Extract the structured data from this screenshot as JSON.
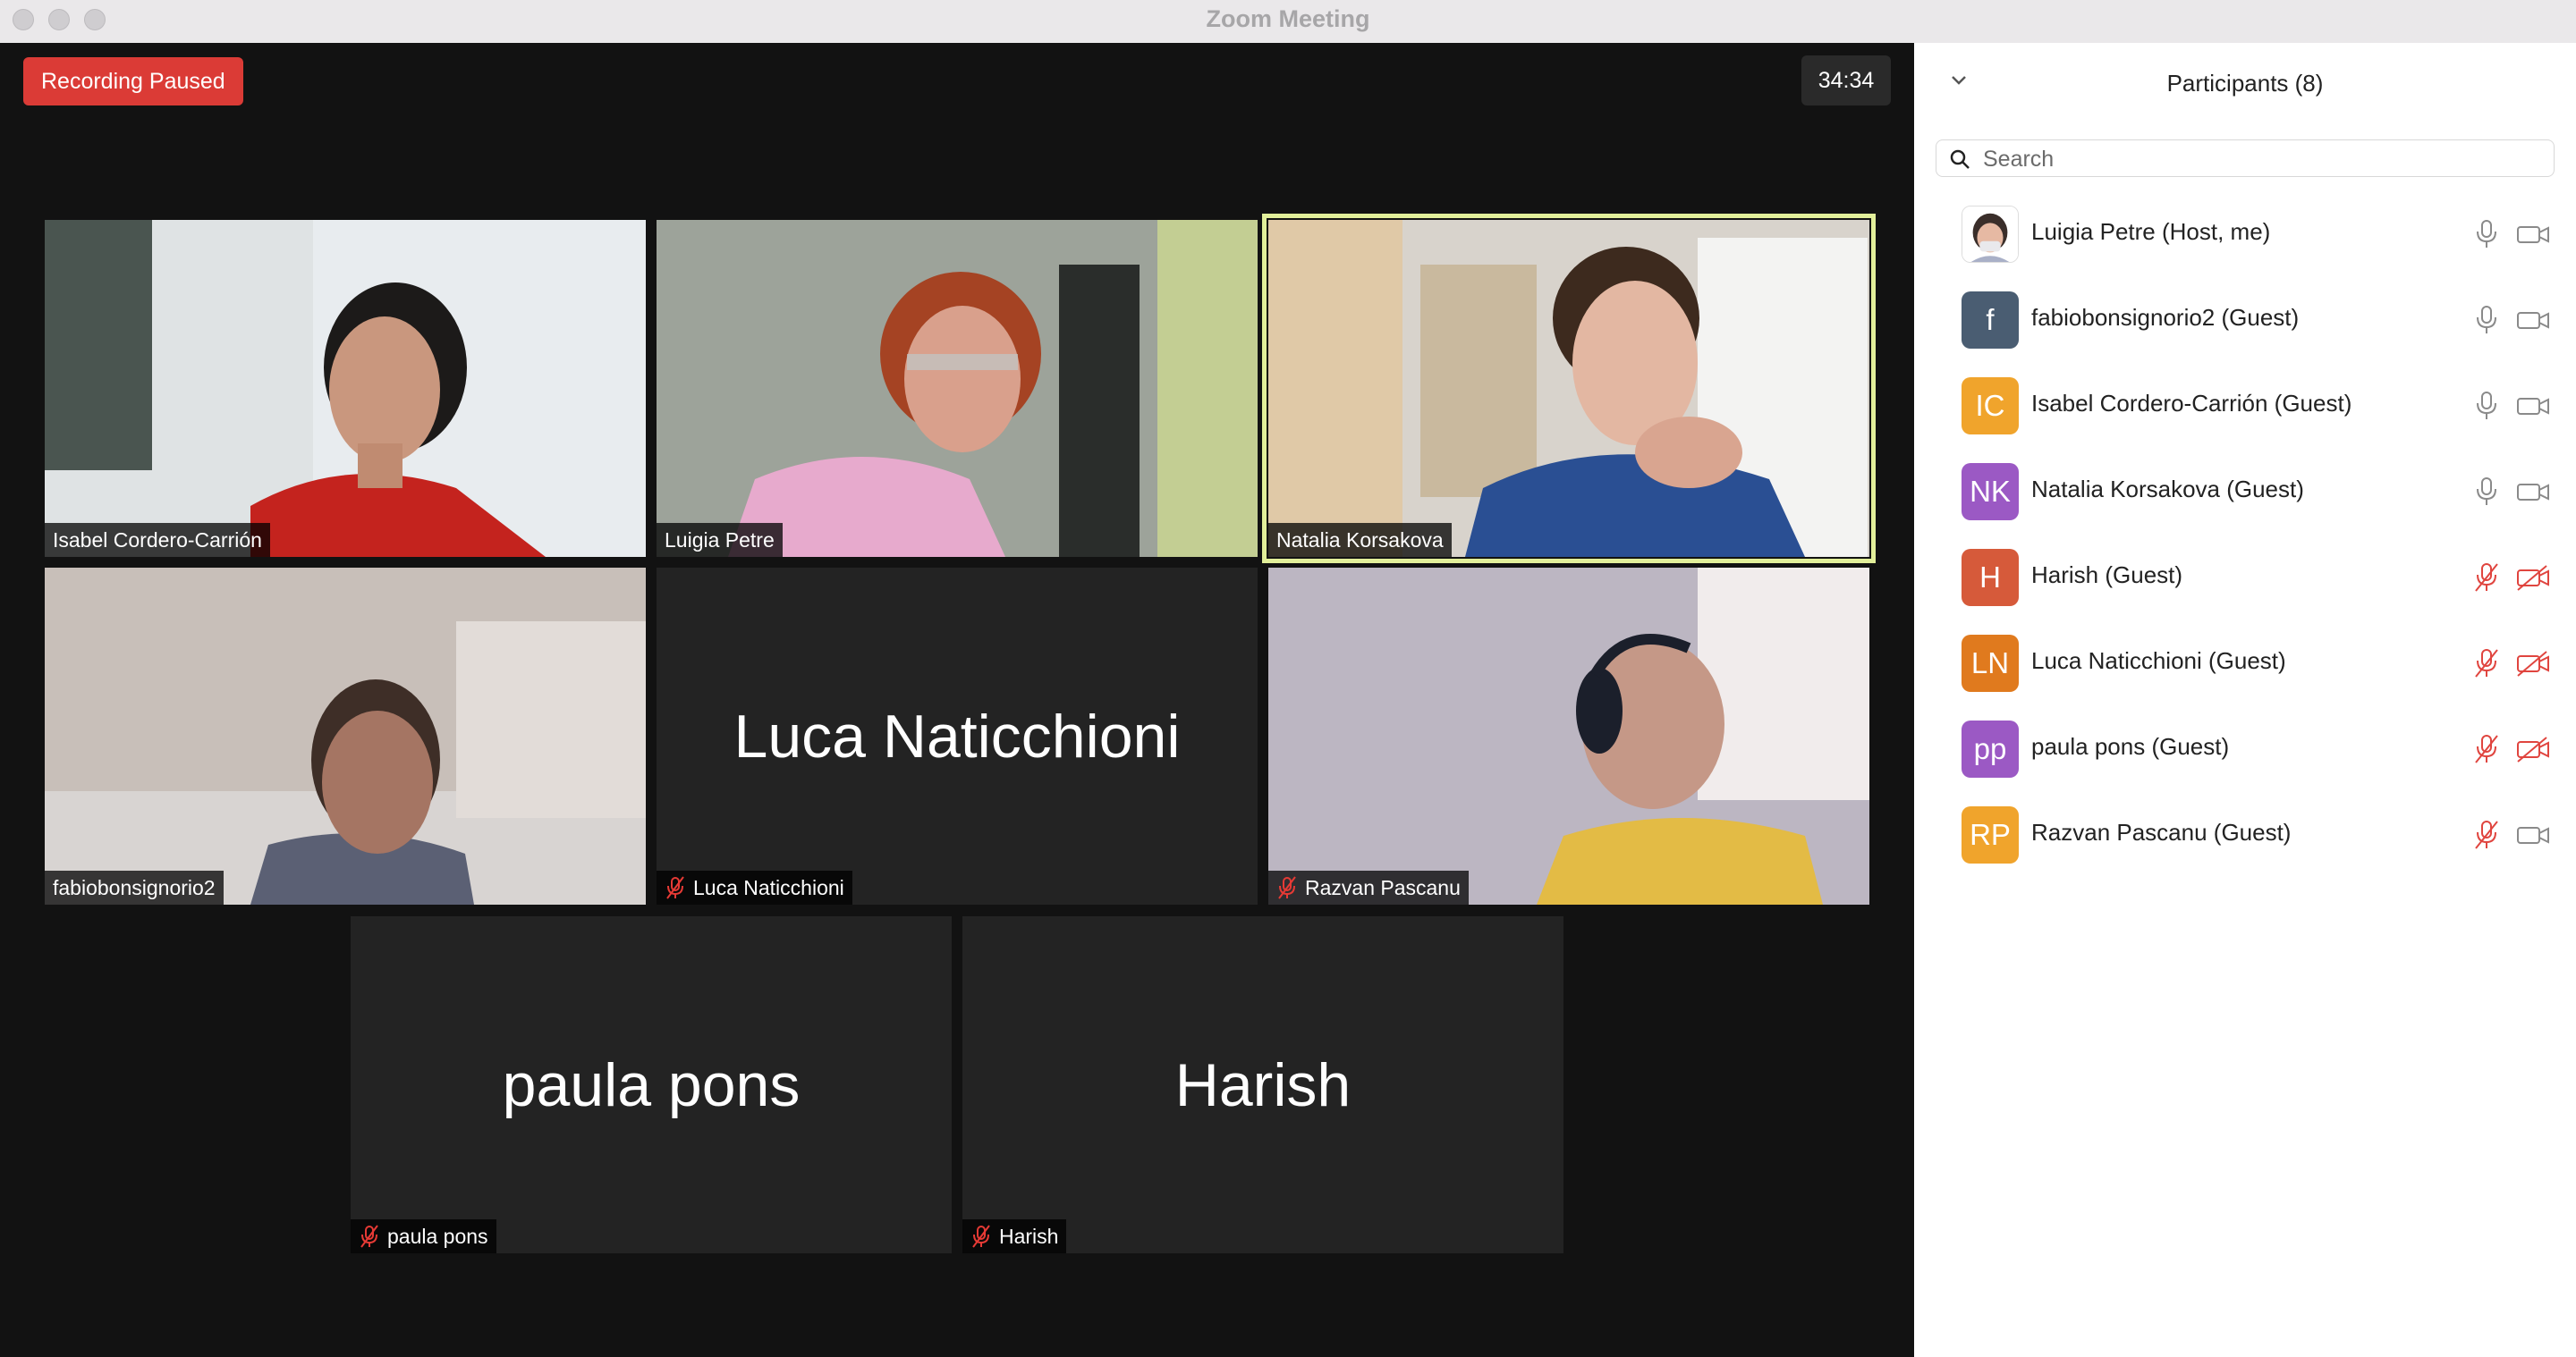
{
  "window": {
    "title": "Zoom Meeting"
  },
  "stage": {
    "recording_status": "Recording Paused",
    "elapsed": "34:34"
  },
  "tiles": [
    {
      "name": "Isabel Cordero-Carrión",
      "video": true,
      "muted": false,
      "speaking": false
    },
    {
      "name": "Luigia Petre",
      "video": true,
      "muted": false,
      "speaking": false
    },
    {
      "name": "Natalia Korsakova",
      "video": true,
      "muted": false,
      "speaking": true
    },
    {
      "name": "fabiobonsignorio2",
      "video": true,
      "muted": false,
      "speaking": false
    },
    {
      "name": "Luca Naticchioni",
      "video": false,
      "muted": true,
      "speaking": false
    },
    {
      "name": "Razvan Pascanu",
      "video": true,
      "muted": true,
      "speaking": false
    },
    {
      "name": "paula pons",
      "video": false,
      "muted": true,
      "speaking": false
    },
    {
      "name": "Harish",
      "video": false,
      "muted": true,
      "speaking": false
    }
  ],
  "participants_panel": {
    "title": "Participants (8)",
    "search_placeholder": "Search",
    "participants": [
      {
        "initials": "",
        "name": "Luigia Petre (Host, me)",
        "avatar_color": "#ffffff",
        "mic_on": true,
        "camera_on": true
      },
      {
        "initials": "f",
        "name": "fabiobonsignorio2 (Guest)",
        "avatar_color": "#4a5d72",
        "mic_on": true,
        "camera_on": true
      },
      {
        "initials": "IC",
        "name": "Isabel Cordero-Carrión (Guest)",
        "avatar_color": "#f0a42c",
        "mic_on": true,
        "camera_on": true
      },
      {
        "initials": "NK",
        "name": "Natalia Korsakova (Guest)",
        "avatar_color": "#9b59c4",
        "mic_on": true,
        "camera_on": true
      },
      {
        "initials": "H",
        "name": "Harish (Guest)",
        "avatar_color": "#d65a3a",
        "mic_on": false,
        "camera_on": false
      },
      {
        "initials": "LN",
        "name": "Luca Naticchioni (Guest)",
        "avatar_color": "#e07a1e",
        "mic_on": false,
        "camera_on": false
      },
      {
        "initials": "pp",
        "name": "paula pons (Guest)",
        "avatar_color": "#9b59c4",
        "mic_on": false,
        "camera_on": false
      },
      {
        "initials": "RP",
        "name": "Razvan Pascanu (Guest)",
        "avatar_color": "#f0a42c",
        "mic_on": false,
        "camera_on": true
      }
    ]
  }
}
